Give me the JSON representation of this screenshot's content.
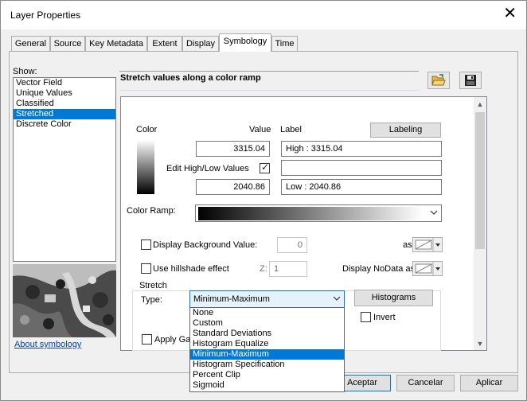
{
  "window": {
    "title": "Layer Properties"
  },
  "tabs": [
    {
      "label": "General"
    },
    {
      "label": "Source"
    },
    {
      "label": "Key Metadata"
    },
    {
      "label": "Extent"
    },
    {
      "label": "Display"
    },
    {
      "label": "Symbology"
    },
    {
      "label": "Time"
    }
  ],
  "show": {
    "label": "Show:",
    "items": [
      {
        "label": "Vector Field"
      },
      {
        "label": "Unique Values"
      },
      {
        "label": "Classified"
      },
      {
        "label": "Stretched"
      },
      {
        "label": "Discrete Color"
      }
    ],
    "selected": "Stretched"
  },
  "about_link": "About symbology",
  "header": {
    "title": "Stretch values along a color ramp"
  },
  "columns": {
    "color": "Color",
    "value": "Value",
    "label": "Label"
  },
  "labeling_button": "Labeling",
  "high": {
    "value": "3315.04",
    "label": "High : 3315.04"
  },
  "edit_high_low": {
    "label": "Edit High/Low Values",
    "checked": true
  },
  "low": {
    "value": "2040.86",
    "label": "Low : 2040.86"
  },
  "color_ramp_label": "Color Ramp:",
  "background": {
    "label": "Display Background Value:",
    "value": "0",
    "as_label": "as"
  },
  "hillshade": {
    "label": "Use hillshade effect",
    "z_label": "Z:",
    "z_value": "1"
  },
  "nodata": {
    "label": "Display NoData as"
  },
  "stretch": {
    "group_label": "Stretch",
    "type_label": "Type:",
    "type_value": "Minimum-Maximum",
    "histograms_button": "Histograms",
    "invert_label": "Invert",
    "apply_gamma_label": "Apply Ga",
    "options": [
      {
        "label": "None"
      },
      {
        "label": "Custom"
      },
      {
        "label": "Standard Deviations"
      },
      {
        "label": "Histogram Equalize"
      },
      {
        "label": "Minimum-Maximum"
      },
      {
        "label": "Histogram Specification"
      },
      {
        "label": "Percent Clip"
      },
      {
        "label": "Sigmoid"
      }
    ]
  },
  "footer": {
    "ok": "Aceptar",
    "cancel": "Cancelar",
    "apply": "Aplicar"
  },
  "colors": {
    "accent": "#0078d7",
    "folder": "#e8b84a"
  }
}
